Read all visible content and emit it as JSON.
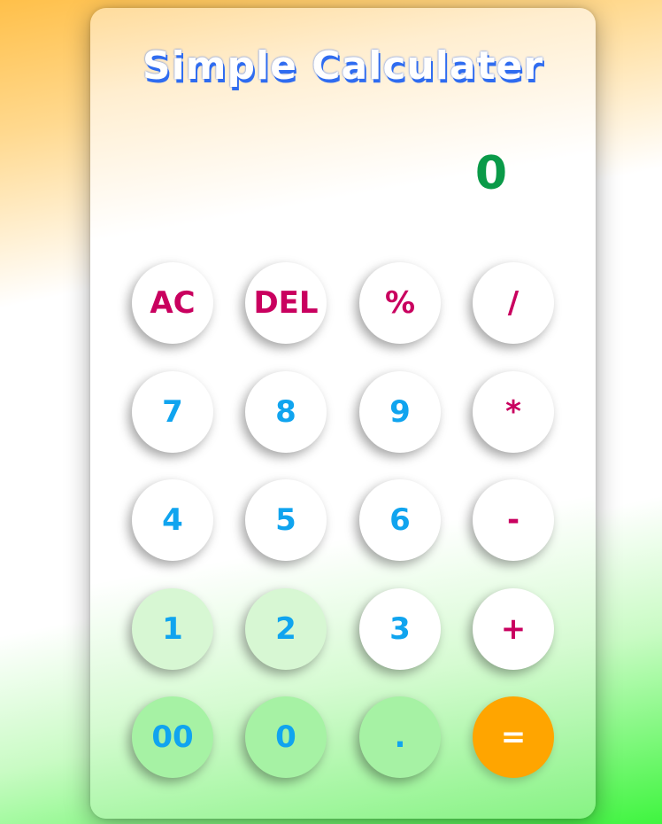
{
  "title": "Simple Calculater",
  "display": {
    "value": "0"
  },
  "keys": {
    "ac": "AC",
    "del": "DEL",
    "percent": "%",
    "divide": "/",
    "seven": "7",
    "eight": "8",
    "nine": "9",
    "multiply": "*",
    "four": "4",
    "five": "5",
    "six": "6",
    "minus": "-",
    "one": "1",
    "two": "2",
    "three": "3",
    "plus": "+",
    "double_zero": "00",
    "zero": "0",
    "decimal": ".",
    "equals": "="
  },
  "colors": {
    "function_key_text": "#c9005f",
    "number_key_text": "#10a4ef",
    "display_text": "#0a9a48",
    "equals_background": "#ffa500",
    "title_shadow": "#2f6cf0"
  }
}
